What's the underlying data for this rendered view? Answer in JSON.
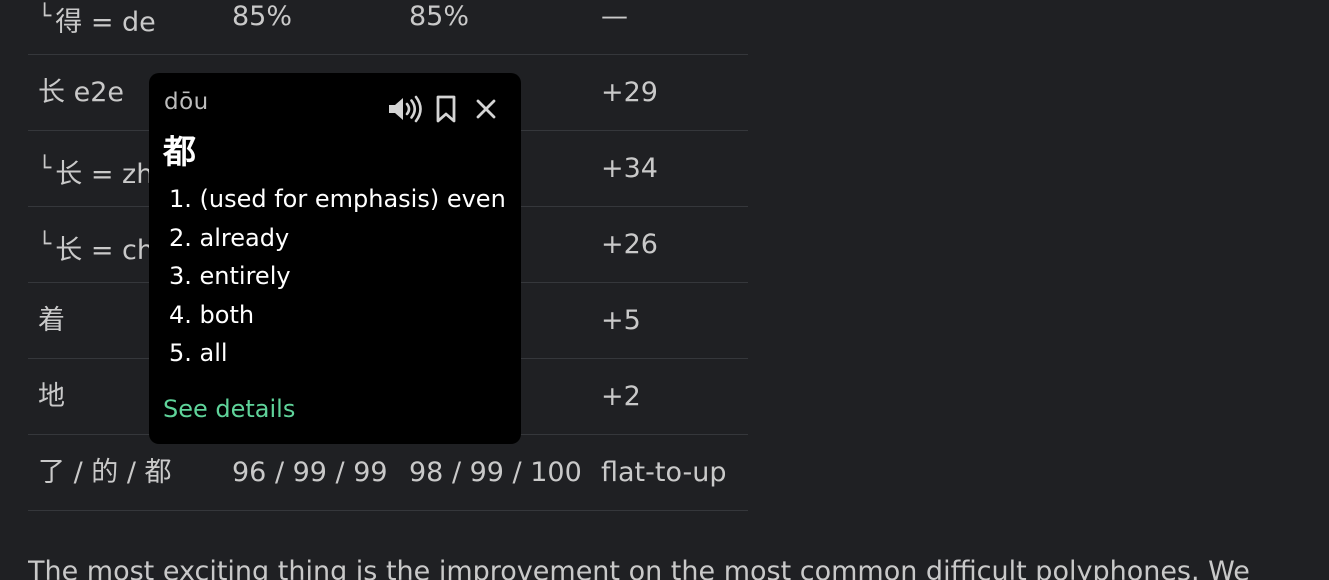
{
  "table": {
    "rows": [
      {
        "sub": true,
        "label": "得 = de",
        "c1": "85%",
        "c2": "85%",
        "c3": "—"
      },
      {
        "sub": false,
        "label": "长 e2e",
        "c1": "",
        "c2": "",
        "c3": "+29"
      },
      {
        "sub": true,
        "label": "长 = zh",
        "c1": "",
        "c2": "",
        "c3": "+34"
      },
      {
        "sub": true,
        "label": "长 = ch",
        "c1": "",
        "c2": "",
        "c3": "+26"
      },
      {
        "sub": false,
        "label": "着",
        "c1": "",
        "c2": "",
        "c3": "+5"
      },
      {
        "sub": false,
        "label": "地",
        "c1": "",
        "c2": "",
        "c3": "+2"
      },
      {
        "sub": false,
        "label": "了 / 的 / 都",
        "c1": "96 / 99 / 99",
        "c2": "98 / 99 / 100",
        "c3": "flat-to-up"
      }
    ],
    "sub_mark": "└"
  },
  "paragraph": "The most exciting thing is the improvement on the most common difficult polyphones. We",
  "popup": {
    "pinyin": "dōu",
    "hanzi": "都",
    "definitions": [
      "1. (used for emphasis) even",
      "2. already",
      "3. entirely",
      "4. both",
      "5. all"
    ],
    "see_details": "See details",
    "icons": [
      "speaker-icon",
      "bookmark-icon",
      "close-icon"
    ]
  }
}
